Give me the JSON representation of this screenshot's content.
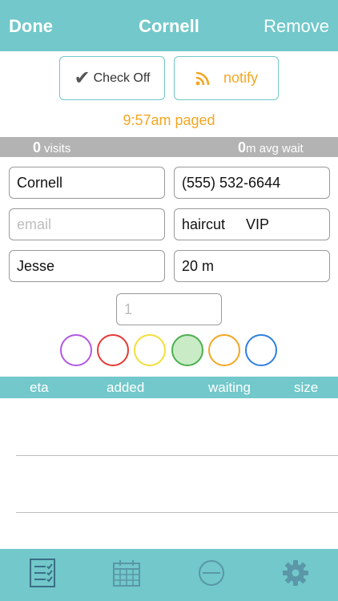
{
  "nav": {
    "left": "Done",
    "title": "Cornell",
    "right": "Remove"
  },
  "actions": {
    "checkoff": "Check Off",
    "notify": "notify"
  },
  "status": {
    "paged": "9:57am paged"
  },
  "stats": {
    "visits_count": "0",
    "visits_label": "visits",
    "wait_count": "0",
    "wait_label": "m avg wait"
  },
  "form": {
    "name": "Cornell",
    "phone": "(555) 532-6644",
    "email_placeholder": "email",
    "tag1": "haircut",
    "tag2": "VIP",
    "staff": "Jesse",
    "time": "20 m",
    "party_placeholder": "1"
  },
  "color_options": [
    "#b158e0",
    "#e53935",
    "#f2df3a",
    "#4caf50",
    "#f5a623",
    "#2f7fe0"
  ],
  "selected_color": "#4caf50",
  "table": {
    "headers": [
      "eta",
      "added",
      "waiting",
      "size"
    ]
  },
  "tabs": [
    "checklist-icon",
    "calendar-icon",
    "minus-circle-icon",
    "gear-icon"
  ]
}
